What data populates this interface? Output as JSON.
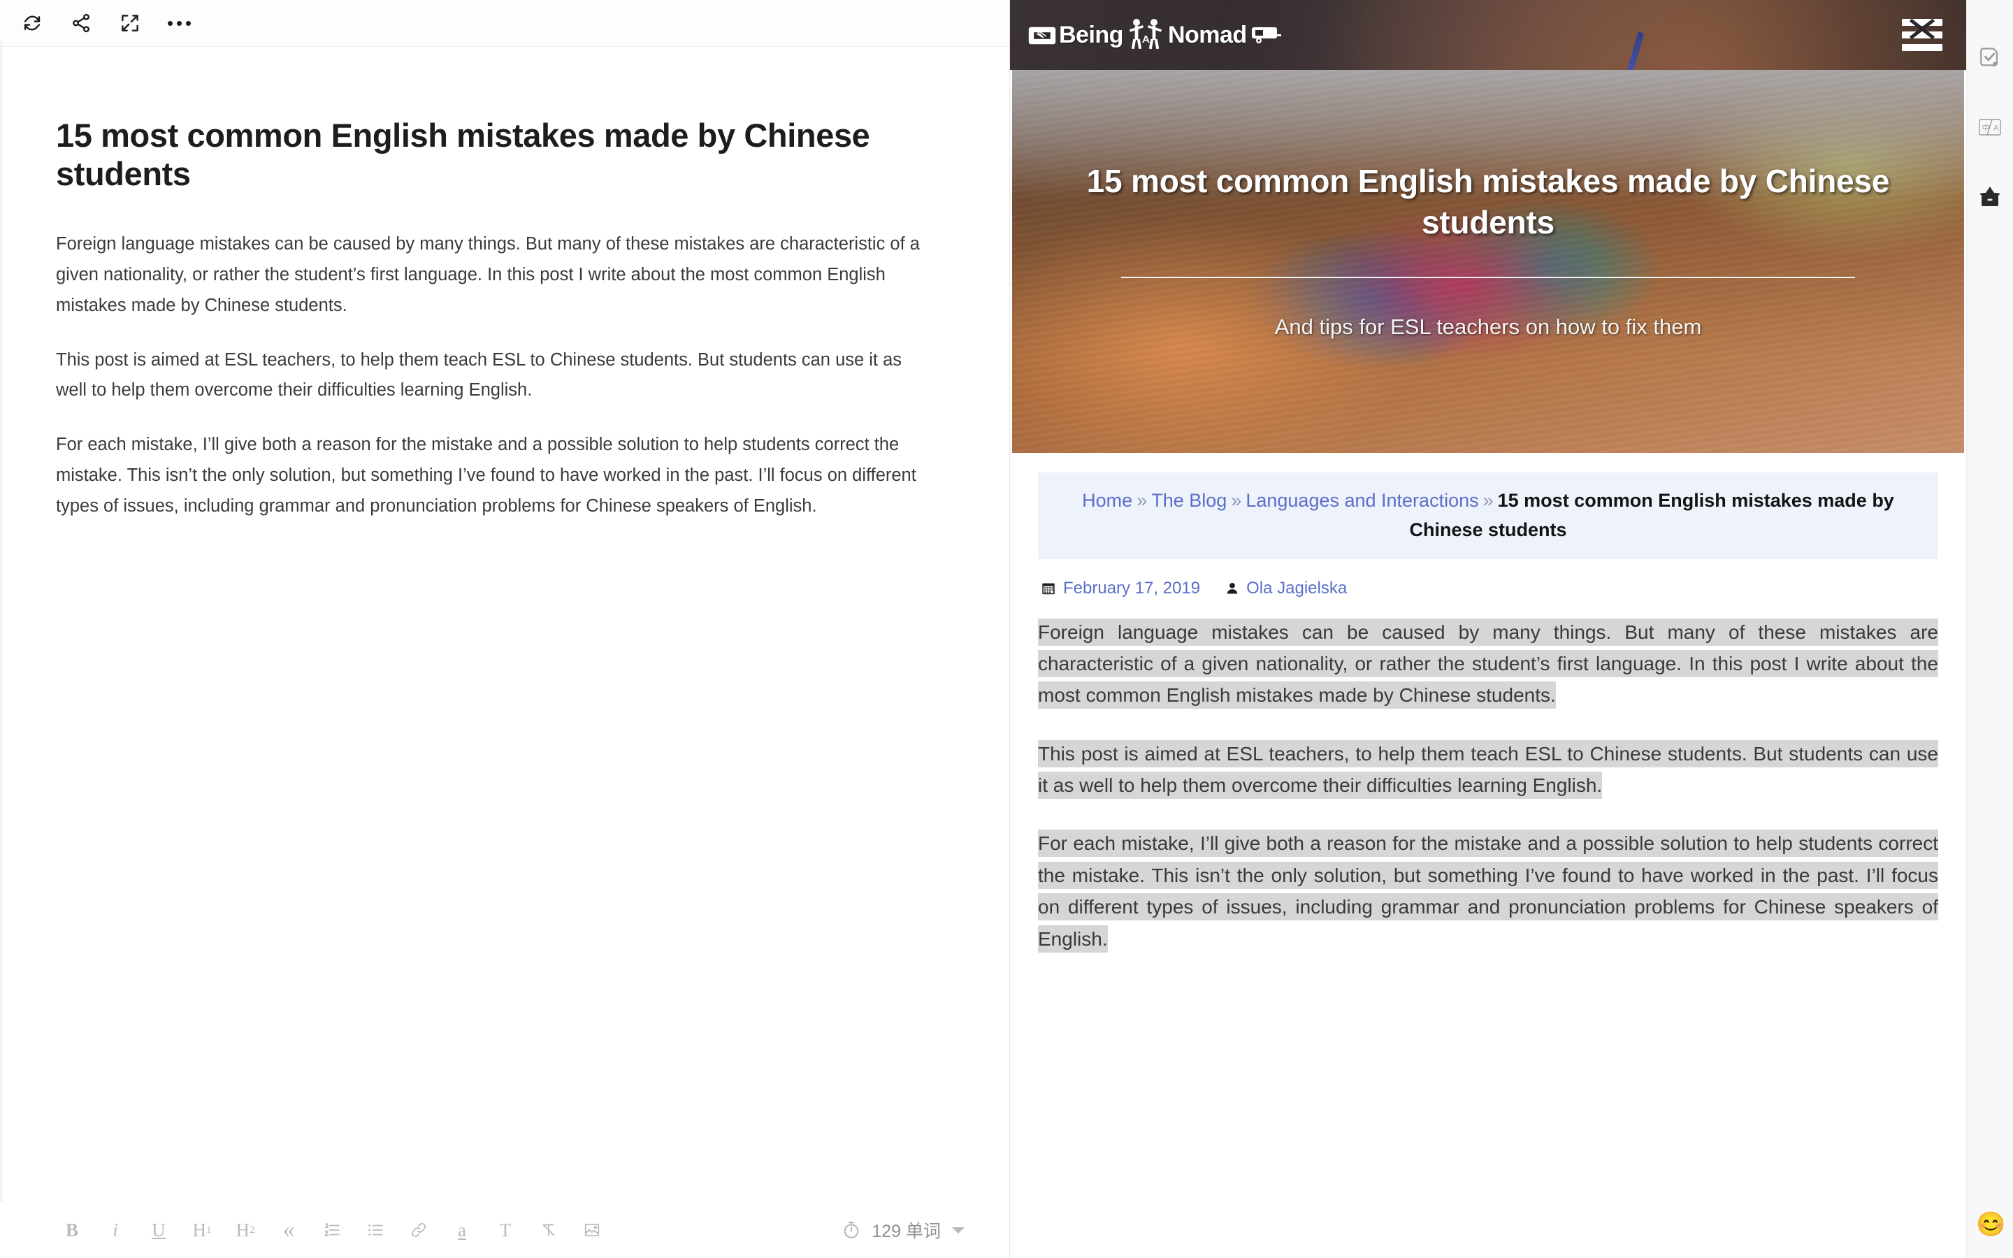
{
  "editor": {
    "toolbar": {
      "refresh_label": "refresh",
      "share_label": "share",
      "fullscreen_label": "fullscreen",
      "more_label": "more options"
    },
    "document": {
      "title": "15 most common English mistakes made by Chinese students",
      "paragraphs": [
        "Foreign language mistakes can be caused by many things. But many of these mistakes are characteristic of a given nationality, or rather the student’s first language. In this post I write about the most common English mistakes made by Chinese students.",
        "This post is aimed at ESL teachers, to help them teach ESL to Chinese students. But students can use it as well to help them overcome their difficulties learning English.",
        "For each mistake, I’ll give both a reason for the mistake and a possible solution to help students correct the mistake. This isn’t the only solution, but something I’ve found to have worked in the past. I’ll focus on different types of issues, including grammar and pronunciation problems for Chinese speakers of English."
      ]
    },
    "format_toolbar": {
      "bold": "B",
      "italic": "i",
      "underline": "U",
      "heading1": "H",
      "heading1_sub": "1",
      "heading2": "H",
      "heading2_sub": "2",
      "quote": "«",
      "ordered_list": "ordered-list",
      "bullet_list": "bullet-list",
      "link": "link",
      "highlight": "a",
      "text_style": "T",
      "clear_format": "clear-format",
      "image": "image"
    },
    "status": {
      "word_count": "129 单词",
      "timer_icon": "timer-icon"
    }
  },
  "web": {
    "site": {
      "logo_word1": "Being",
      "logo_word_a": "A",
      "logo_word2": "Nomad",
      "menu_label": "menu"
    },
    "hero": {
      "title": "15 most common English mistakes made by Chinese students",
      "subtitle": "And tips for ESL teachers on how to fix them"
    },
    "breadcrumb": {
      "items": [
        {
          "label": "Home",
          "link": true
        },
        {
          "label": "The Blog",
          "link": true
        },
        {
          "label": "Languages and Interactions",
          "link": true
        }
      ],
      "separator": "»",
      "current": "15 most common English mistakes made by Chinese students"
    },
    "meta": {
      "date_icon": "calendar-icon",
      "date": "February 17, 2019",
      "author_icon": "user-icon",
      "author": "Ola Jagielska"
    },
    "paragraphs": [
      "Foreign language mistakes can be caused by many things. But many of these mistakes are characteristic of a given nationality, or rather the student’s first language. In this post I write about the most common English mistakes made by Chinese students.",
      "This post is aimed at ESL teachers, to help them teach ESL to Chinese students. But students can use it as well to help them overcome their difficulties learning English.",
      "For each mistake, I’ll give both a reason for the mistake and a possible solution to help students correct the mistake. This isn’t the only solution, but something I’ve found to have worked in the past. I’ll focus on different types of issues, including grammar and pronunciation problems for Chinese speakers of English."
    ]
  },
  "rail": {
    "items": [
      {
        "icon": "document-check-icon",
        "label": "proofread"
      },
      {
        "icon": "translate-icon",
        "label": "translate"
      },
      {
        "icon": "archive-box-icon",
        "label": "collect"
      }
    ],
    "emoji": "😊"
  },
  "colors": {
    "accent_link": "#5b6fc9",
    "breadcrumb_bg": "#eef2fb",
    "selection_bg": "#d6d6d6",
    "header_bg": "#2b2629",
    "rail_bg": "#f8f8f8"
  }
}
